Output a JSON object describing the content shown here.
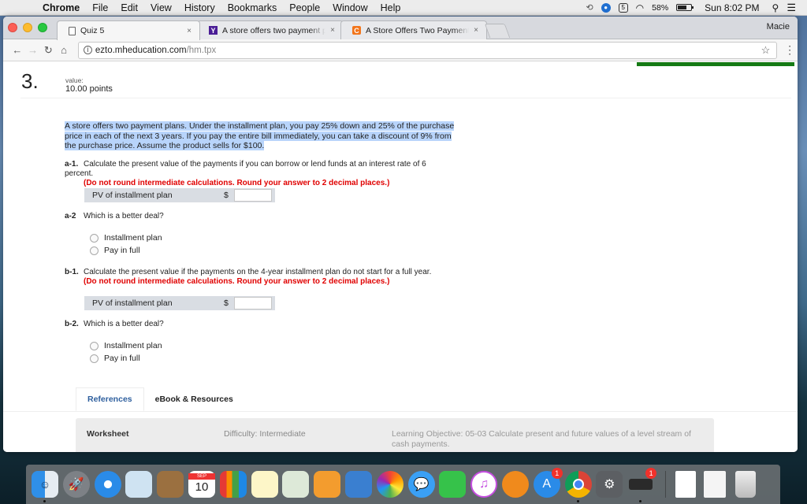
{
  "menubar": {
    "app_name": "Chrome",
    "items": [
      "File",
      "Edit",
      "View",
      "History",
      "Bookmarks",
      "People",
      "Window",
      "Help"
    ],
    "battery_percent": "58%",
    "clock": "Sun 8:02 PM",
    "status_icons": [
      "sync-icon",
      "1password-icon",
      "five-icon",
      "wifi-icon",
      "battery-icon",
      "spotlight-icon",
      "notification-center-icon"
    ]
  },
  "browser": {
    "tabs": [
      {
        "title": "Quiz 5",
        "favicon": "page-icon",
        "active": true
      },
      {
        "title": "A store offers two payment pla",
        "favicon": "yahoo-icon",
        "favicon_letter": "Y",
        "active": false
      },
      {
        "title": "A Store Offers Two Payment P",
        "favicon": "chegg-icon",
        "favicon_letter": "C",
        "active": false
      }
    ],
    "close_glyph": "×",
    "profile_name": "Macie",
    "url_domain": "ezto.mheducation.com",
    "url_path": "/hm.tpx",
    "accent_color": "#157a14"
  },
  "question": {
    "number": "3.",
    "value_label": "value:",
    "points": "10.00 points",
    "problem_text": "A store offers two payment plans. Under the installment plan, you pay 25% down and 25% of the purchase price in each of the next 3 years. If you pay the entire bill immediately, you can take a discount of 9% from the purchase price. Assume the product sells for $100.",
    "parts": {
      "a1": {
        "label": "a-1.",
        "text": "Calculate the present value of the payments if you can borrow or lend funds at an interest rate of 6 percent.",
        "instruction": "(Do not round intermediate calculations. Round your answer to 2 decimal places.)",
        "answer_label": "PV of installment plan",
        "currency": "$",
        "answer_value": ""
      },
      "a2": {
        "label": "a-2",
        "text": "Which is a better deal?",
        "options": [
          "Installment plan",
          "Pay in full"
        ]
      },
      "b1": {
        "label": "b-1.",
        "text": "Calculate the present value if the payments on the 4-year installment plan do not start for a full year.",
        "instruction": "(Do not round intermediate calculations. Round your answer to 2 decimal places.)",
        "answer_label": "PV of installment plan",
        "currency": "$",
        "answer_value": ""
      },
      "b2": {
        "label": "b-2.",
        "text": "Which is a better deal?",
        "options": [
          "Installment plan",
          "Pay in full"
        ]
      }
    }
  },
  "references": {
    "tabs": [
      "References",
      "eBook & Resources"
    ],
    "worksheet": "Worksheet",
    "difficulty": "Difficulty: Intermediate",
    "learning_objective": "Learning Objective: 05-03 Calculate present and future values of a level stream of cash payments."
  },
  "dock": {
    "apps": [
      {
        "name": "finder",
        "running": true
      },
      {
        "name": "launchpad"
      },
      {
        "name": "safari"
      },
      {
        "name": "mail"
      },
      {
        "name": "contacts"
      },
      {
        "name": "calendar",
        "month": "SEP",
        "day": "10"
      },
      {
        "name": "numbers"
      },
      {
        "name": "notes"
      },
      {
        "name": "maps"
      },
      {
        "name": "pages"
      },
      {
        "name": "keynote"
      },
      {
        "name": "photos"
      },
      {
        "name": "messages"
      },
      {
        "name": "facetime"
      },
      {
        "name": "itunes"
      },
      {
        "name": "ibooks"
      },
      {
        "name": "app-store",
        "badge": "1"
      },
      {
        "name": "chrome",
        "running": true
      },
      {
        "name": "system-preferences"
      },
      {
        "name": "printer",
        "badge": "1",
        "running": true
      }
    ],
    "stack_items": [
      "document",
      "screenshot",
      "trash"
    ]
  }
}
